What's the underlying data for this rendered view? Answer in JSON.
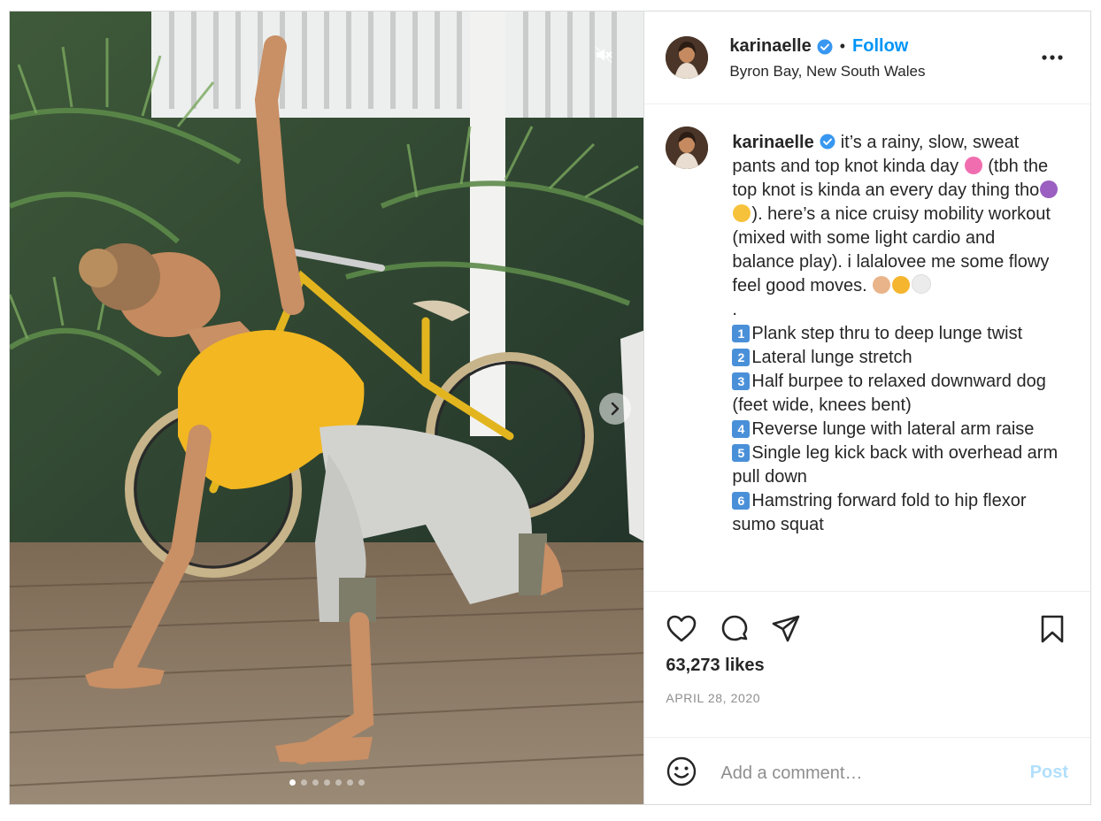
{
  "header": {
    "username": "karinaelle",
    "separator": "•",
    "follow_label": "Follow",
    "location": "Byron Bay, New South Wales"
  },
  "media": {
    "carousel_count": 7,
    "carousel_active_index": 0,
    "mute_icon": "speaker-muted-icon",
    "next_icon": "chevron-right-icon"
  },
  "caption": {
    "username": "karinaelle",
    "line1": "it’s a rainy, slow, sweat pants and top knot kinda day",
    "line1_tail": " (tbh the top knot is kinda an every day thing tho",
    "line1_end": "). here’s a nice cruisy mobility workout (mixed with some light cardio and balance play). i lalalovee me some flowy feel good moves.",
    "dot": ".",
    "steps": [
      {
        "num": "1",
        "text": "Plank step thru to deep lunge twist"
      },
      {
        "num": "2",
        "text": "Lateral lunge stretch"
      },
      {
        "num": "3",
        "text": "Half burpee to relaxed downward dog (feet wide, knees bent)"
      },
      {
        "num": "4",
        "text": "Reverse lunge with lateral arm raise"
      },
      {
        "num": "5",
        "text": "Single leg kick back with overhead arm pull down"
      },
      {
        "num": "6",
        "text": "Hamstring forward fold to hip flexor sumo squat"
      }
    ]
  },
  "actions": {
    "likes": "63,273 likes",
    "date": "APRIL 28, 2020",
    "icons": [
      "heart-icon",
      "comment-icon",
      "share-icon",
      "bookmark-icon"
    ]
  },
  "comment": {
    "placeholder": "Add a comment…",
    "post_label": "Post"
  },
  "colors": {
    "accent": "#0095f6",
    "post_disabled": "#b2dffc",
    "verified": "#3897f0",
    "muted_text": "#8e8e8e"
  }
}
